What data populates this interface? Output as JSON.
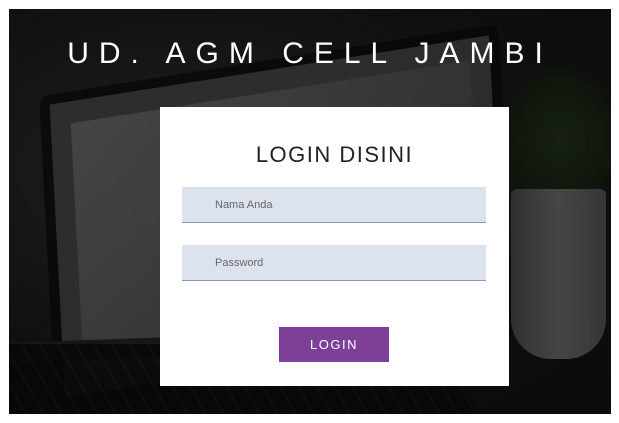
{
  "header": {
    "brand": "UD. AGM CELL JAMBI"
  },
  "login": {
    "title": "LOGIN DISINI",
    "name_placeholder": "Nama Anda",
    "password_placeholder": "Password",
    "button_label": "LOGIN"
  },
  "colors": {
    "button_bg": "#7d3f98",
    "input_bg": "#dde3ee",
    "card_bg": "#ffffff"
  }
}
